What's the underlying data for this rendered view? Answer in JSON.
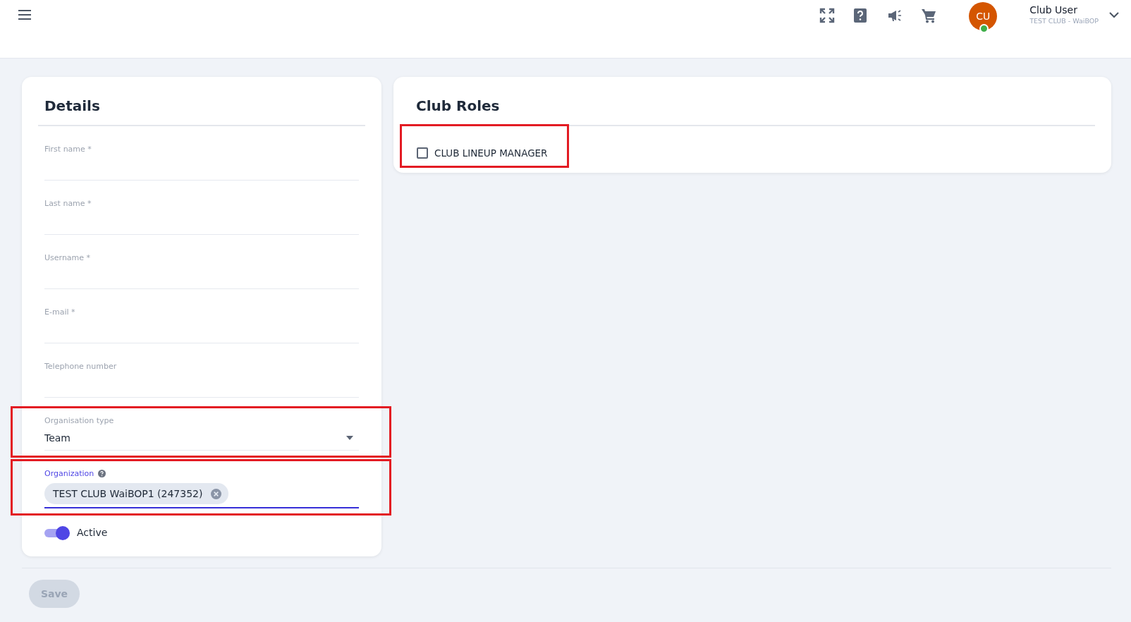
{
  "header": {
    "avatar_initials": "CU",
    "online": true,
    "user_name": "Club User",
    "user_club": "TEST CLUB - WaiBOP"
  },
  "details": {
    "title": "Details",
    "fields": [
      {
        "kind": "text",
        "label": "First name *",
        "highlighted": false,
        "focused": false
      },
      {
        "kind": "text",
        "label": "Last name *",
        "highlighted": false,
        "focused": false
      },
      {
        "kind": "text",
        "label": "Username *",
        "highlighted": false,
        "focused": false
      },
      {
        "kind": "text",
        "label": "E-mail *",
        "highlighted": false,
        "focused": false
      },
      {
        "kind": "text",
        "label": "Telephone number",
        "highlighted": false,
        "focused": false
      },
      {
        "kind": "select",
        "label": "Organisation type",
        "value": "Team",
        "highlighted": true,
        "focused": false
      },
      {
        "kind": "chips",
        "label": "Organization",
        "chips": [
          "TEST CLUB WaiBOP1 (247352)"
        ],
        "highlighted": true,
        "focused": true
      }
    ],
    "toggle": {
      "label": "Active",
      "on": true
    }
  },
  "club_roles": {
    "title": "Club Roles",
    "roles": [
      {
        "label": "CLUB LINEUP MANAGER",
        "checked": false,
        "highlighted": true
      }
    ]
  },
  "save_button": {
    "label": "Save",
    "disabled": true
  }
}
